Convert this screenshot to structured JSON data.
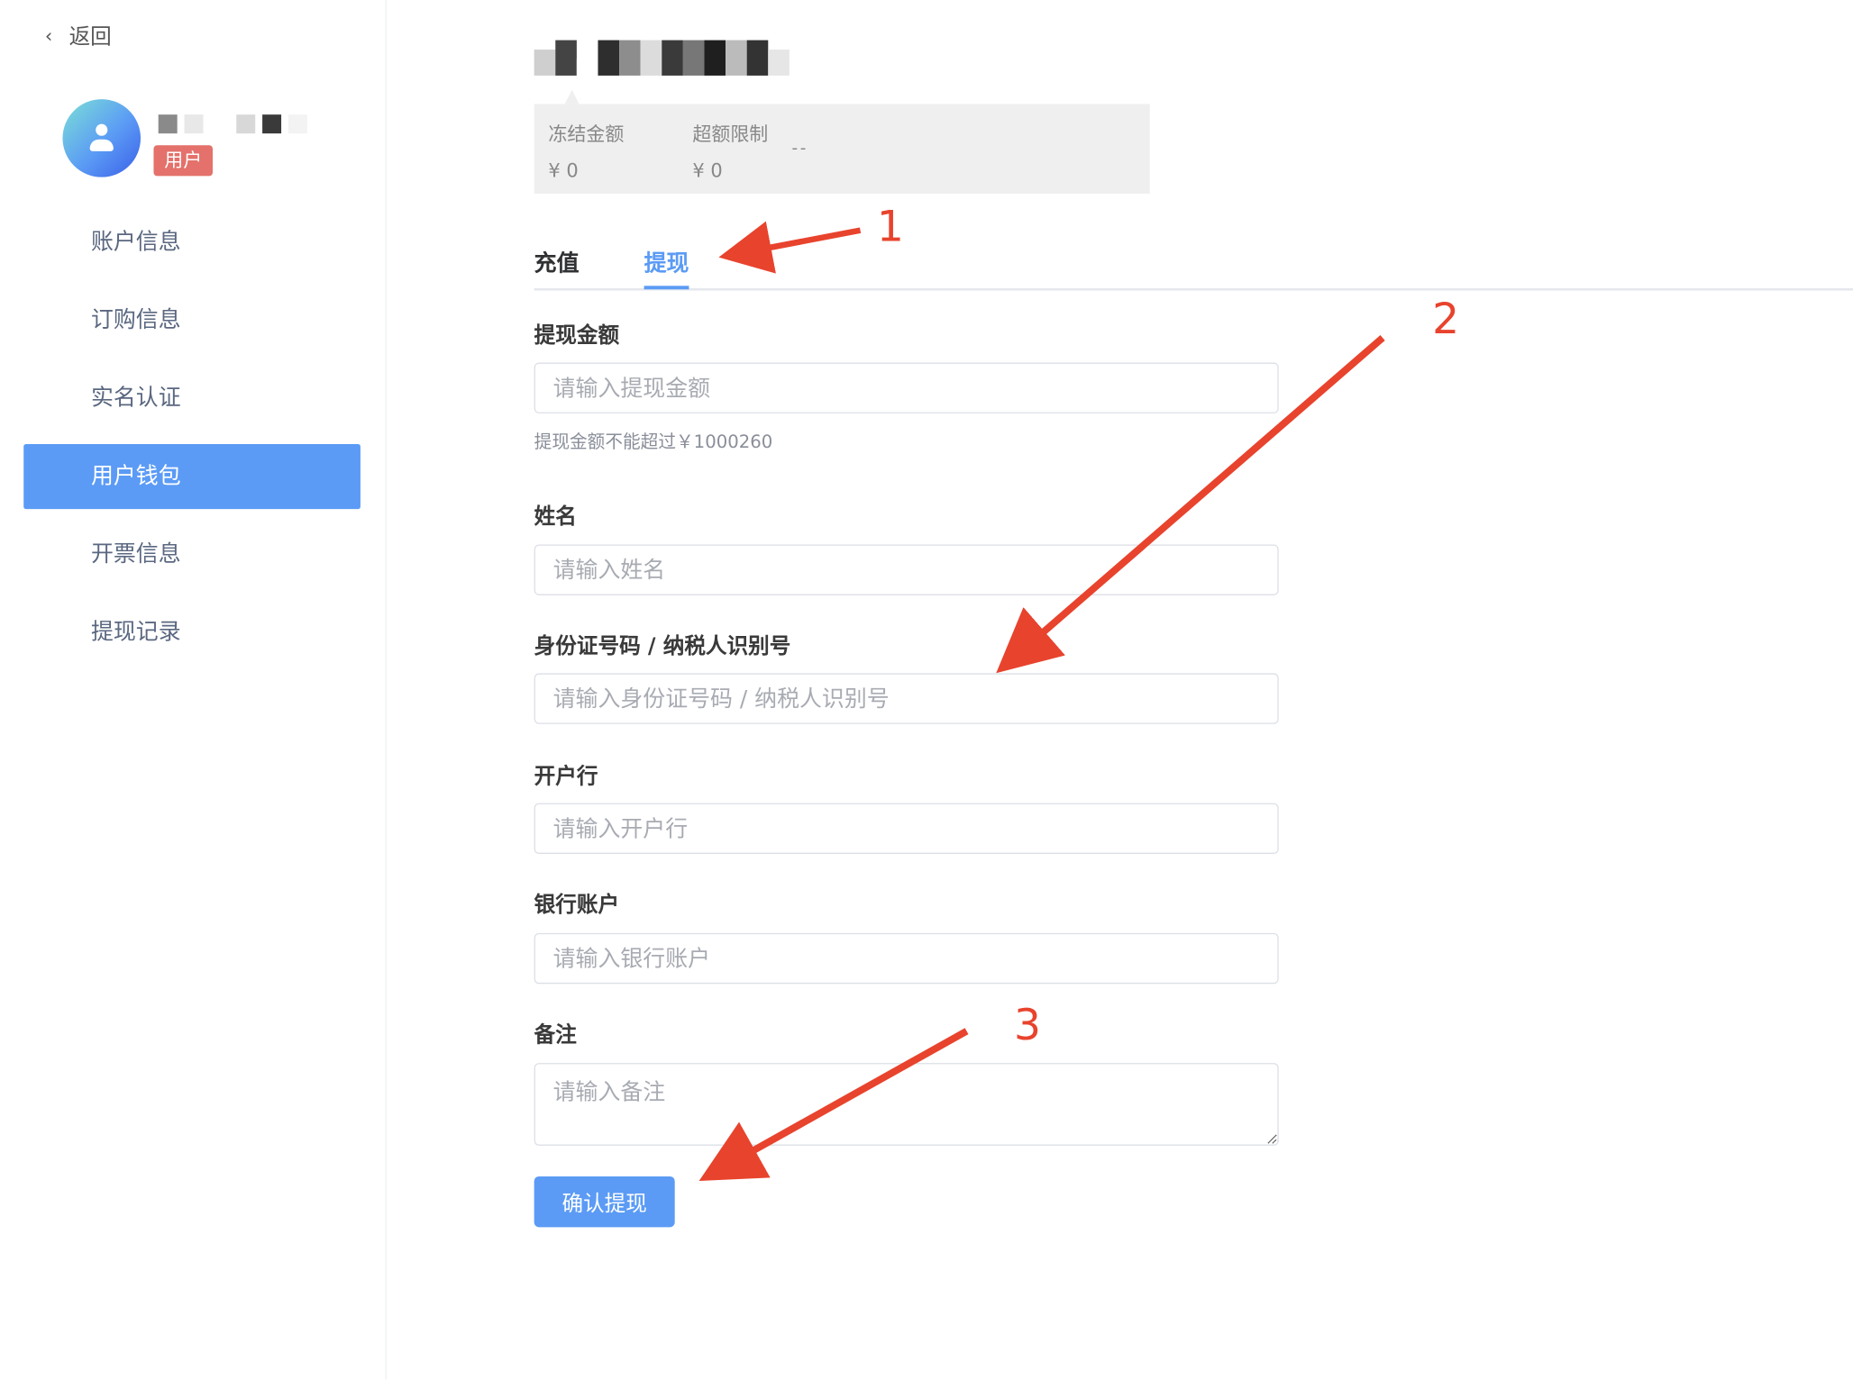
{
  "sidebar": {
    "back_label": "返回",
    "role_badge": "用户",
    "items": [
      {
        "label": "账户信息"
      },
      {
        "label": "订购信息"
      },
      {
        "label": "实名认证"
      },
      {
        "label": "用户钱包",
        "active": true
      },
      {
        "label": "开票信息"
      },
      {
        "label": "提现记录"
      }
    ]
  },
  "stats": {
    "frozen_label": "冻结金额",
    "frozen_value": "¥ 0",
    "separator": "--",
    "limit_label": "超额限制",
    "limit_value": "¥ 0"
  },
  "tabs": {
    "recharge": "充值",
    "withdraw": "提现",
    "active": "withdraw"
  },
  "form": {
    "amount_label": "提现金额",
    "amount_placeholder": "请输入提现金额",
    "amount_hint": "提现金额不能超过￥1000260",
    "name_label": "姓名",
    "name_placeholder": "请输入姓名",
    "id_label": "身份证号码 / 纳税人识别号",
    "id_placeholder": "请输入身份证号码 / 纳税人识别号",
    "bank_label": "开户行",
    "bank_placeholder": "请输入开户行",
    "account_label": "银行账户",
    "account_placeholder": "请输入银行账户",
    "note_label": "备注",
    "note_placeholder": "请输入备注",
    "submit_label": "确认提现"
  },
  "annotations": {
    "step1": "1",
    "step2": "2",
    "step3": "3",
    "arrow_color": "#e8432d"
  },
  "colors": {
    "accent": "#5b9bf5",
    "badge": "#e4716b"
  }
}
